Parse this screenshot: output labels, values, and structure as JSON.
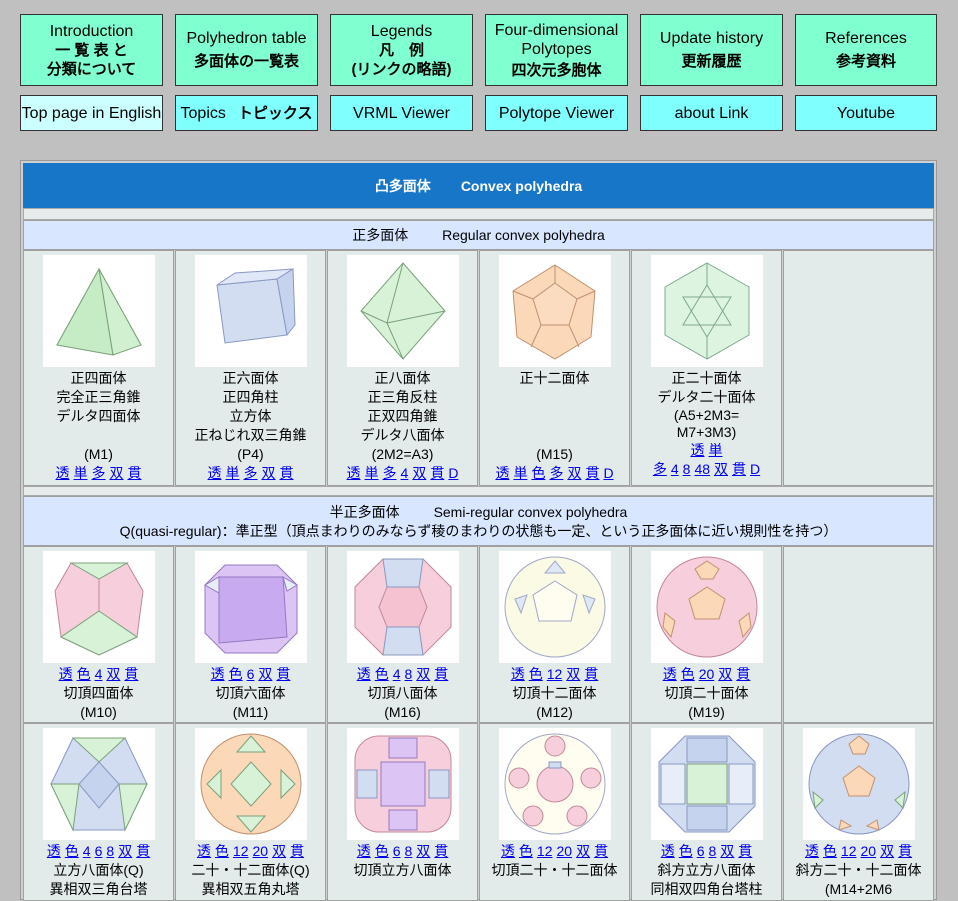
{
  "nav_row1": [
    {
      "en": "Introduction",
      "jp": "一 覧 表 と\n分類について"
    },
    {
      "en": "Polyhedron table",
      "jp": "多面体の一覧表"
    },
    {
      "en": "Legends",
      "jp": "凡　例\n(リンクの略語)"
    },
    {
      "en": "Four-dimensional\nPolytopes",
      "jp": "四次元多胞体"
    },
    {
      "en": "Update history",
      "jp": "更新履歴"
    },
    {
      "en": "References",
      "jp": "参考資料"
    }
  ],
  "nav_row2": [
    {
      "en": "Top page in English",
      "jp": ""
    },
    {
      "en": "Topics",
      "jp": "トピックス"
    },
    {
      "en": "VRML Viewer",
      "jp": ""
    },
    {
      "en": "Polytope Viewer",
      "jp": ""
    },
    {
      "en": "about Link",
      "jp": ""
    },
    {
      "en": "Youtube",
      "jp": ""
    }
  ],
  "header": {
    "jp": "凸多面体",
    "en": "Convex polyhedra"
  },
  "regular": {
    "jp": "正多面体",
    "en": "Regular convex polyhedra",
    "items": [
      {
        "lines": [
          "正四面体",
          "完全正三角錐",
          "デルタ四面体",
          "",
          "(M1)"
        ],
        "links": [
          "透",
          "単",
          "多",
          "双",
          "貫"
        ]
      },
      {
        "lines": [
          "正六面体",
          "正四角柱",
          "立方体",
          "正ねじれ双三角錐",
          "(P4)"
        ],
        "links": [
          "透",
          "単",
          "多",
          "双",
          "貫"
        ]
      },
      {
        "lines": [
          "正八面体",
          "正三角反柱",
          "正双四角錐",
          "デルタ八面体",
          "(2M2=A3)"
        ],
        "links": [
          "透",
          "単",
          "多",
          "4",
          "双",
          "貫",
          "D"
        ]
      },
      {
        "lines": [
          "正十二面体",
          "",
          "",
          "",
          "(M15)"
        ],
        "links": [
          "透",
          "単",
          "色",
          "多",
          "双",
          "貫",
          "D"
        ]
      },
      {
        "lines": [
          "正二十面体",
          "デルタ二十面体",
          "(A5+2M3=",
          "M7+3M3)"
        ],
        "links1": [
          "透",
          "単"
        ],
        "links": [
          "多",
          "4",
          "8",
          "48",
          "双",
          "貫",
          "D"
        ]
      }
    ]
  },
  "semiregular": {
    "jp": "半正多面体",
    "en": "Semi-regular convex polyhedra",
    "note": "Q(quasi-regular)：準正型（頂点まわりのみならず稜のまわりの状態も一定、という正多面体に近い規則性を持つ）",
    "row1": [
      {
        "links": [
          "透",
          "色",
          "4",
          "双",
          "貫"
        ],
        "lines": [
          "切頂四面体",
          "(M10)"
        ]
      },
      {
        "links": [
          "透",
          "色",
          "6",
          "双",
          "貫"
        ],
        "lines": [
          "切頂六面体",
          "(M11)"
        ]
      },
      {
        "links": [
          "透",
          "色",
          "4",
          "8",
          "双",
          "貫"
        ],
        "lines": [
          "切頂八面体",
          "(M16)"
        ]
      },
      {
        "links": [
          "透",
          "色",
          "12",
          "双",
          "貫"
        ],
        "lines": [
          "切頂十二面体",
          "(M12)"
        ]
      },
      {
        "links": [
          "透",
          "色",
          "20",
          "双",
          "貫"
        ],
        "lines": [
          "切頂二十面体",
          "(M19)"
        ]
      }
    ],
    "row2": [
      {
        "links": [
          "透",
          "色",
          "4",
          "6",
          "8",
          "双",
          "貫"
        ],
        "lines": [
          "立方八面体(Q)",
          "異相双三角台塔"
        ]
      },
      {
        "links": [
          "透",
          "色",
          "12",
          "20",
          "双",
          "貫"
        ],
        "lines": [
          "二十・十二面体(Q)",
          "異相双五角丸塔"
        ]
      },
      {
        "links": [
          "透",
          "色",
          "6",
          "8",
          "双",
          "貫"
        ],
        "lines": [
          "切頂立方八面体"
        ]
      },
      {
        "links": [
          "透",
          "色",
          "12",
          "20",
          "双",
          "貫"
        ],
        "lines": [
          "切頂二十・十二面体"
        ]
      },
      {
        "links": [
          "透",
          "色",
          "6",
          "8",
          "双",
          "貫"
        ],
        "lines": [
          "斜方立方八面体",
          "同相双四角台塔柱"
        ]
      },
      {
        "links": [
          "透",
          "色",
          "12",
          "20",
          "双",
          "貫"
        ],
        "lines": [
          "斜方二十・十二面体",
          "(M14+2M6"
        ]
      }
    ]
  },
  "colors": {
    "blue_header": "#1876c8",
    "section": "#d8e6ff",
    "link": "#0000ee"
  }
}
